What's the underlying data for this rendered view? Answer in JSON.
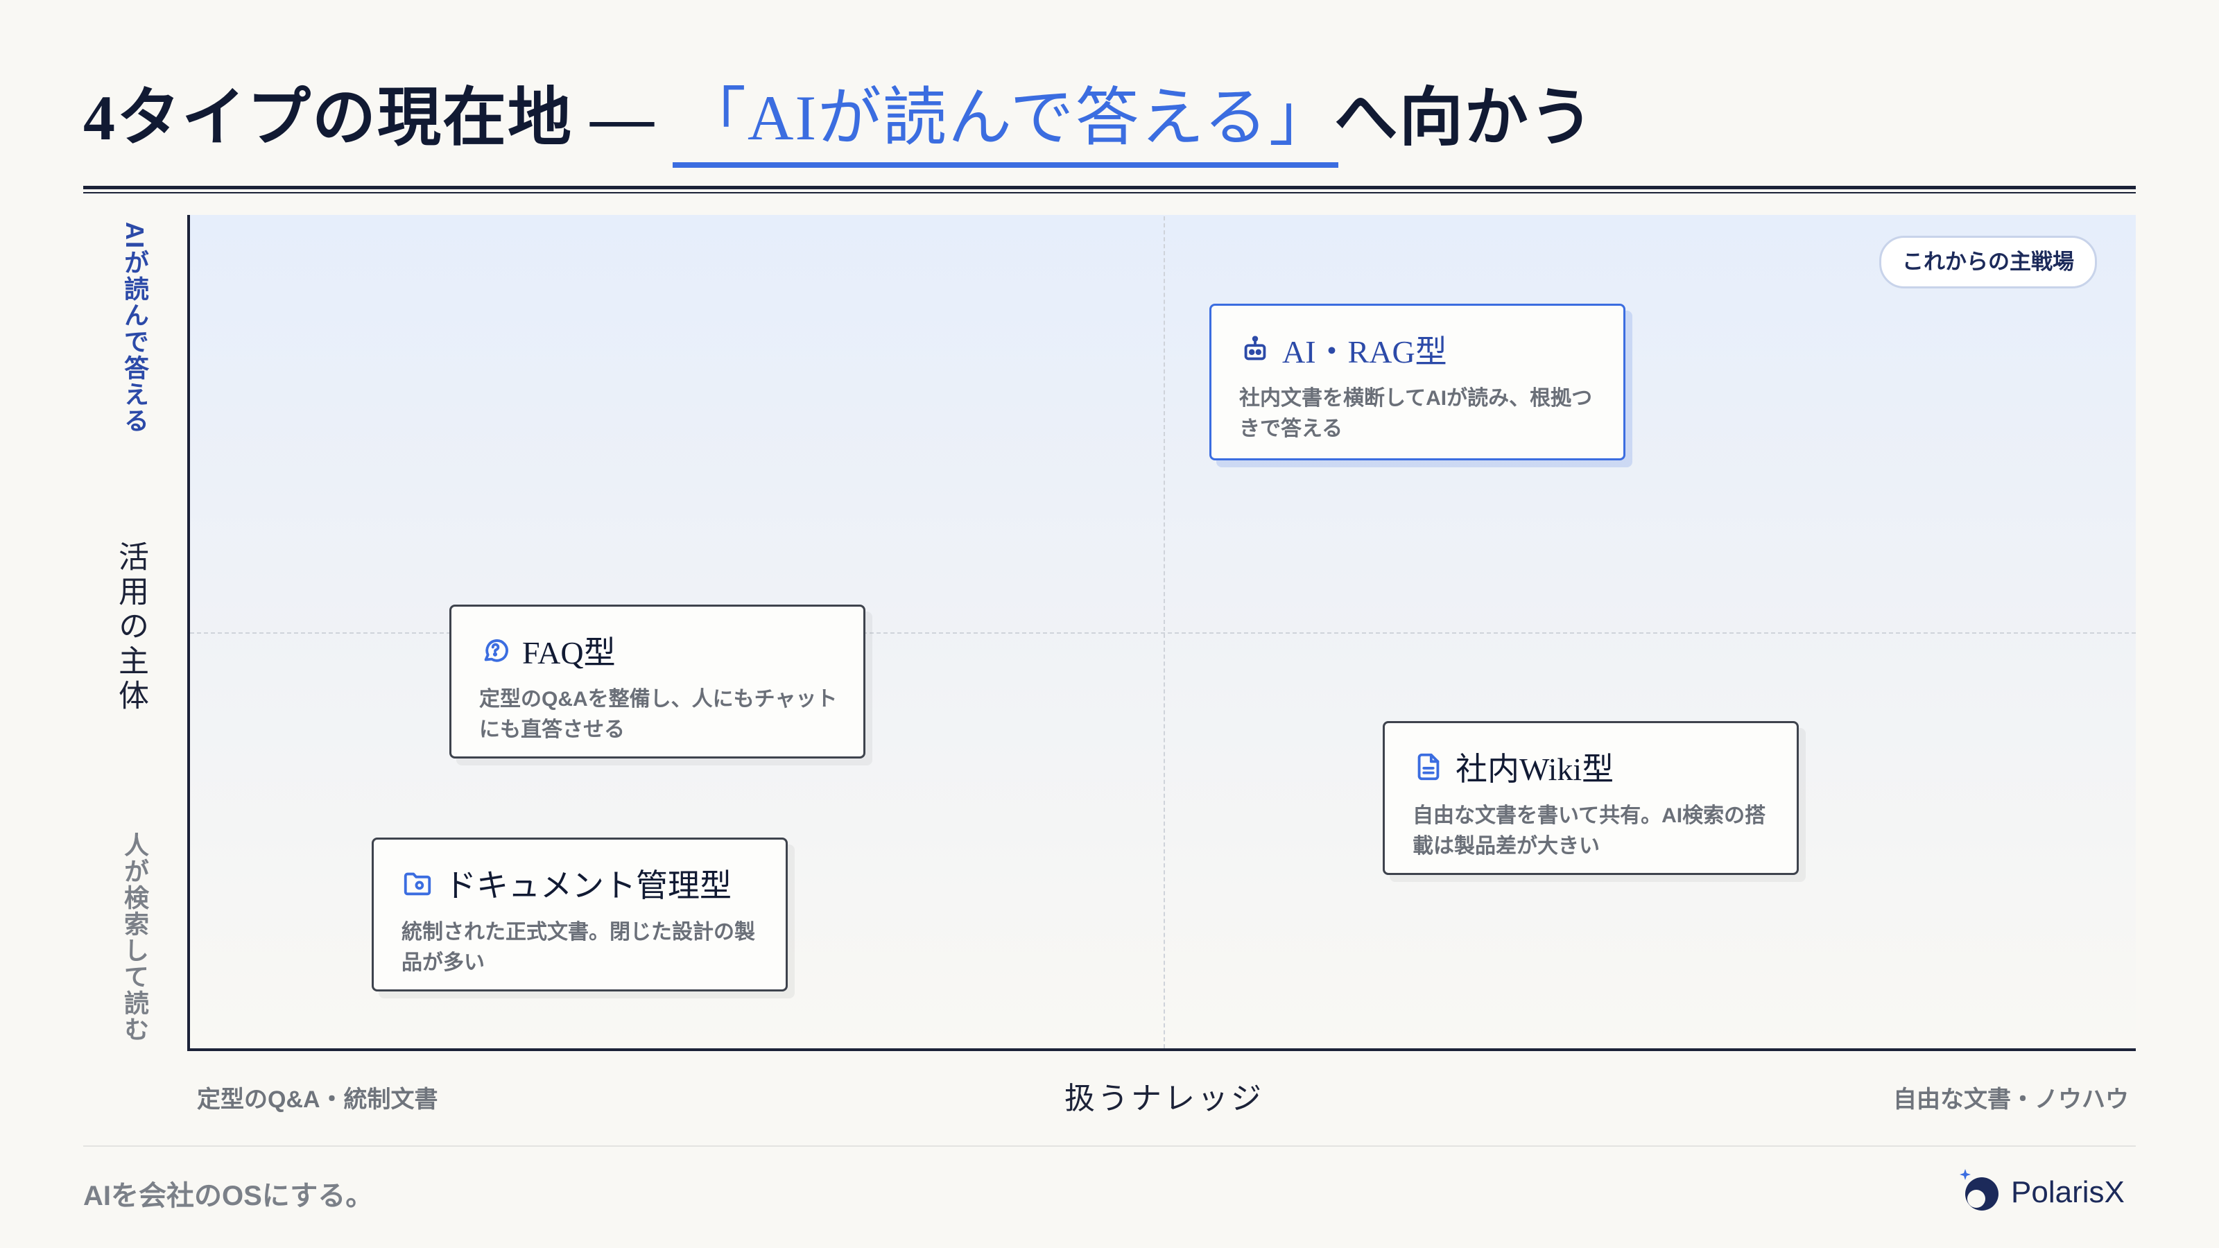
{
  "title": {
    "prefix": "4タイプの現在地 — ",
    "highlight": "「AIが読んで答える」",
    "suffix": "へ向かう"
  },
  "y_axis": {
    "top": "AIが読んで答える",
    "middle": "活用の主体",
    "bottom": "人が検索して読む"
  },
  "x_axis": {
    "left": "定型のQ&A・統制文書",
    "middle": "扱うナレッジ",
    "right": "自由な文書・ノウハウ"
  },
  "badge": "これからの主戦場",
  "quadrants": [
    {
      "id": "ai-rag",
      "title": "AI・RAG型",
      "icon": "robot-icon",
      "description": "社内文書を横断してAIが読み、根拠つきで答える",
      "highlighted": true
    },
    {
      "id": "faq",
      "title": "FAQ型",
      "icon": "chat-question-icon",
      "description": "定型のQ&Aを整備し、人にもチャットにも直答させる"
    },
    {
      "id": "wiki",
      "title": "社内Wiki型",
      "icon": "document-icon",
      "description": "自由な文書を書いて共有。AI検索の搭載は製品差が大きい"
    },
    {
      "id": "doc-mgmt",
      "title": "ドキュメント管理型",
      "icon": "folder-icon",
      "description": "統制された正式文書。閉じた設計の製品が多い"
    }
  ],
  "footer": {
    "tagline": "AIを会社のOSにする。",
    "logo_text": "PolarisX"
  },
  "colors": {
    "accent": "#3b6de0",
    "navy": "#1c2238",
    "muted": "#6f747c",
    "background": "#f9f8f4"
  }
}
